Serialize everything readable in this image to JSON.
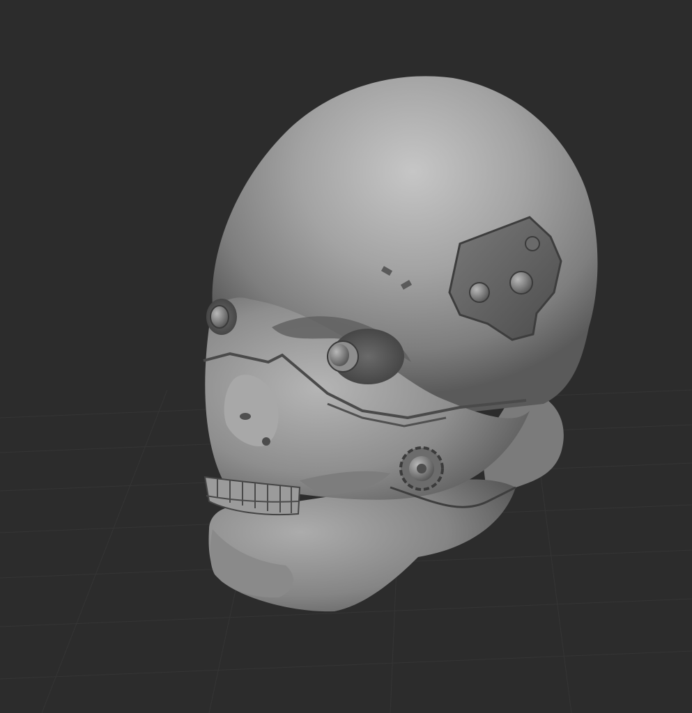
{
  "viewport": {
    "background_color": "#2c2c2c",
    "grid_color": "#3a3a3a",
    "grid_visible": true
  },
  "model": {
    "object": "cyborg-skull-sculpt",
    "material_color": "#9a9a9a",
    "highlight_color": "#c4c4c4",
    "shadow_color": "#4a4a4a",
    "mechanical_color": "#5e5e5e"
  }
}
